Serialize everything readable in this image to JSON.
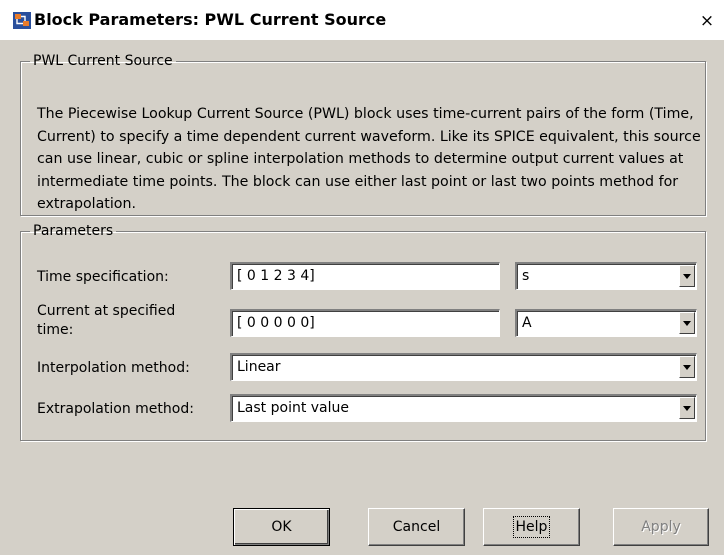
{
  "window": {
    "title": "Block Parameters: PWL Current Source",
    "close_glyph": "×"
  },
  "description_group": {
    "legend": "PWL Current Source",
    "text": "The Piecewise Lookup Current Source (PWL) block uses time-current pairs of the form (Time, Current) to specify a time dependent current waveform. Like its SPICE equivalent, this source can use linear, cubic or spline interpolation methods to determine output current values at intermediate time points. The block can use either last point or last two points method for extrapolation."
  },
  "parameters": {
    "legend": "Parameters",
    "time_spec": {
      "label": "Time specification:",
      "value": "[ 0 1 2 3 4]",
      "unit": "s"
    },
    "current": {
      "label": "Current at specified time:",
      "value": "[ 0 0 0 0 0]",
      "unit": "A"
    },
    "interpolation": {
      "label": "Interpolation method:",
      "value": "Linear"
    },
    "extrapolation": {
      "label": "Extrapolation method:",
      "value": "Last point value"
    }
  },
  "buttons": {
    "ok": "OK",
    "cancel": "Cancel",
    "help": "Help",
    "apply": "Apply"
  },
  "icons": {
    "app": "simulink-block-icon",
    "close": "close-icon",
    "dropdown": "chevron-down-icon"
  },
  "colors": {
    "dialog_bg": "#d4d0c8",
    "titlebar_bg": "#ffffff",
    "field_bg": "#ffffff"
  }
}
